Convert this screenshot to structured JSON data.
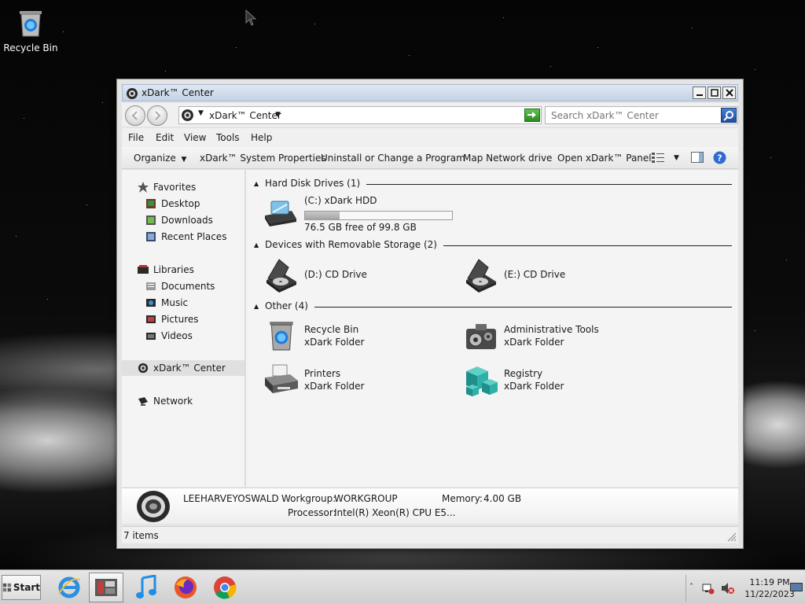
{
  "desktop": {
    "recycle_bin_label": "Recycle Bin"
  },
  "window": {
    "title": "xDark™ Center",
    "address": {
      "location": "xDark™ Center"
    },
    "search": {
      "placeholder": "Search xDark™ Center"
    },
    "menu": [
      "File",
      "Edit",
      "View",
      "Tools",
      "Help"
    ],
    "toolbar": {
      "organize": "Organize",
      "system_properties": "xDark™ System Properties",
      "uninstall": "Uninstall or Change a Program",
      "map_network": "Map Network drive",
      "open_panel": "Open xDark™ Panel"
    },
    "nav": {
      "favorites": "Favorites",
      "desktop": "Desktop",
      "downloads": "Downloads",
      "recent_places": "Recent Places",
      "libraries": "Libraries",
      "documents": "Documents",
      "music": "Music",
      "pictures": "Pictures",
      "videos": "Videos",
      "xdark_center": "xDark™ Center",
      "network": "Network"
    },
    "groups": {
      "hdd": "Hard Disk Drives (1)",
      "removable": "Devices with Removable Storage (2)",
      "other": "Other (4)"
    },
    "drives": {
      "c_name": "(C:) xDark HDD",
      "c_free": "76.5 GB free of 99.8 GB",
      "c_used_fraction": 0.233,
      "d_name": "(D:) CD Drive",
      "e_name": "(E:) CD Drive"
    },
    "other_items": {
      "recycle_bin": "Recycle Bin",
      "recycle_bin_type": "xDark Folder",
      "admin_tools": "Administrative Tools",
      "admin_tools_type": "xDark Folder",
      "printers": "Printers",
      "printers_type": "xDark Folder",
      "registry": "Registry",
      "registry_type": "xDark Folder"
    },
    "details": {
      "computer_name": "LEEHARVEYOSWALD",
      "workgroup_label": "Workgroup:",
      "workgroup": "WORKGROUP",
      "memory_label": "Memory:",
      "memory": "4.00 GB",
      "processor_label": "Processor:",
      "processor": "Intel(R) Xeon(R) CPU E5..."
    },
    "status": "7 items"
  },
  "taskbar": {
    "start": "Start",
    "time": "11:19 PM",
    "date": "11/22/2023"
  },
  "colors": {
    "accent_blue": "#2f6bd1",
    "title_bg": "#c4d2e4"
  }
}
